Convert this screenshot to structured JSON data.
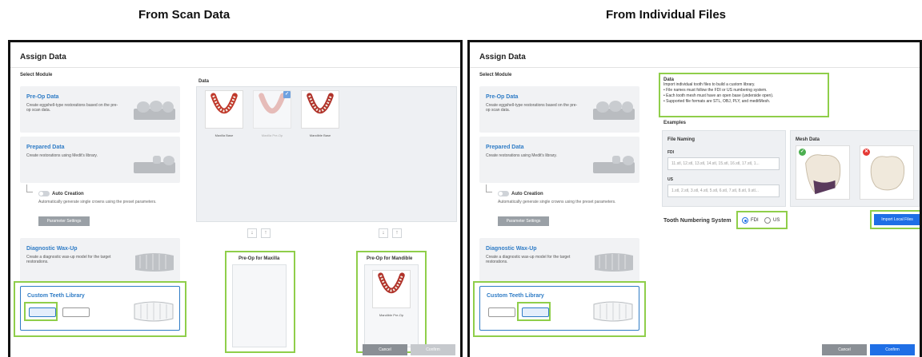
{
  "headings": {
    "left": "From Scan Data",
    "right": "From Individual Files"
  },
  "dialog": {
    "title": "Assign Data",
    "select_module": "Select Module",
    "cancel": "Cancel",
    "confirm": "Confirm"
  },
  "modules": {
    "preop": {
      "title": "Pre-Op Data",
      "desc": "Create eggshell-type restorations based on the pre-op scan data."
    },
    "prepared": {
      "title": "Prepared Data",
      "desc": "Create restorations using Medit's library."
    },
    "auto": {
      "label": "Auto Creation",
      "desc": "Automatically generate single crowns using the preset parameters.",
      "param_button": "Parameter Settings"
    },
    "waxup": {
      "title": "Diagnostic Wax-Up",
      "desc": "Create a diagnostic wax-up model for the target restorations."
    },
    "custom": {
      "title": "Custom Teeth Library"
    }
  },
  "scan": {
    "data_label": "Data",
    "thumbnails": [
      "Maxilla Base",
      "Maxilla Pre-Op",
      "Mandible Base"
    ],
    "preop_maxilla": "Pre-Op for Maxilla",
    "preop_mandible": "Pre-Op for Mandible",
    "mandible_item": "Mandible Pre-Op"
  },
  "files": {
    "data_label": "Data",
    "info_lines": [
      "Import individual tooth files to build a custom library.",
      "• File names must follow the FDI or US numbering system.",
      "• Each tooth mesh must have an open base (underside open).",
      "• Supported file formats are STL, OBJ, PLY, and meditMesh."
    ],
    "examples": "Examples",
    "file_naming": "File Naming",
    "mesh_data": "Mesh Data",
    "fdi_label": "FDI",
    "fdi_value": "11.stl, 12.stl, 13.stl, 14.stl, 15.stl, 16.stl, 17.stl, 1...",
    "us_label": "US",
    "us_value": "1.stl, 2.stl, 3.stl, 4.stl, 5.stl, 6.stl, 7.stl, 8.stl, 9.stl...",
    "numbering_label": "Tooth Numbering System",
    "opt_fdi": "FDI",
    "opt_us": "US",
    "import_button": "Import Local Files"
  },
  "colors": {
    "accent": "#2f7cc6",
    "highlight": "#8fce4a",
    "confirm": "#1f6fe6"
  }
}
